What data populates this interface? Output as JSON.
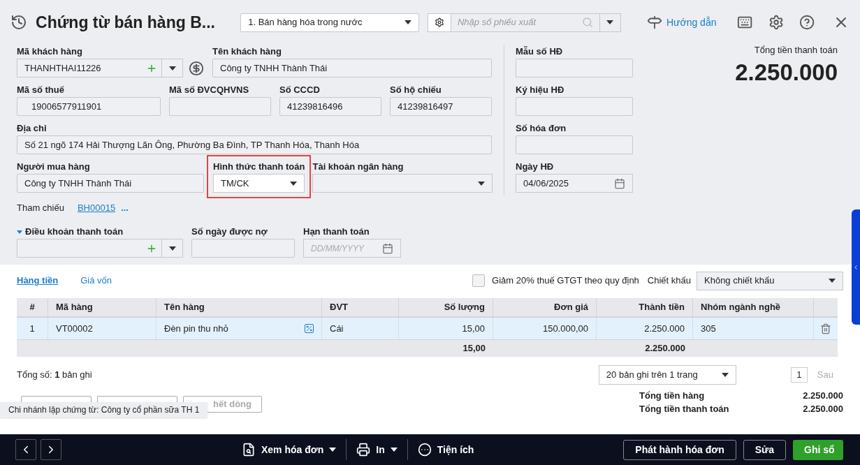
{
  "header": {
    "title": "Chứng từ bán hàng B...",
    "voucher_type": "1. Bán hàng hóa trong nước",
    "search": {
      "placeholder": "Nhập số phiếu xuất"
    },
    "guide": "Hướng dẫn"
  },
  "customer": {
    "code_label": "Mã khách hàng",
    "code": "THANHTHAI11226",
    "name_label": "Tên khách hàng",
    "name": "Công ty TNHH Thành Thái"
  },
  "ids": [
    {
      "label": "Mã số thuế",
      "value": "19006577911901"
    },
    {
      "label": "Mã số ĐVCQHVNS"
    },
    {
      "label": "Số CCCD",
      "value": "41239816496"
    },
    {
      "label": "Số hộ chiếu",
      "value": "41239816497"
    }
  ],
  "address": {
    "label": "Địa chỉ",
    "value": "Số 21 ngõ 174 Hải Thượng Lãn Ông, Phường Ba Đình, TP Thanh Hóa, Thanh Hóa"
  },
  "buyer": {
    "label": "Người mua hàng",
    "value": "Công ty TNHH Thành Thái"
  },
  "payment_method": {
    "label": "Hình thức thanh toán",
    "value": "TM/CK",
    "highlighted": true
  },
  "bank_account": {
    "label": "Tài khoản ngân hàng"
  },
  "reference": {
    "label": "Tham chiếu",
    "link": "BH00015",
    "more": "..."
  },
  "terms": {
    "label": "Điều khoản thanh toán",
    "expanded": true,
    "days_label": "Số ngày được nợ",
    "due_label": "Hạn thanh toán",
    "due_placeholder": "DD/MM/YYYY"
  },
  "invoice": [
    {
      "label": "Mẫu số HĐ",
      "kind": "text"
    },
    {
      "label": "Ký hiệu HĐ",
      "kind": "text"
    },
    {
      "label": "Số hóa đơn",
      "kind": "text"
    },
    {
      "label": "Ngày HĐ",
      "value": "04/06/2025",
      "kind": "date"
    }
  ],
  "total": {
    "label": "Tổng tiền thanh toán",
    "value": "2.250.000"
  },
  "tabs": [
    {
      "label": "Hàng tiền",
      "selected": true
    },
    {
      "label": "Giá vốn",
      "selected": false
    }
  ],
  "vat_reduction": {
    "label": "Giảm 20% thuế GTGT theo quy định",
    "checked": false
  },
  "discount": {
    "label": "Chiết khấu",
    "value": "Không chiết khấu"
  },
  "table": {
    "columns": [
      "#",
      "Mã hàng",
      "Tên hàng",
      "ĐVT",
      "Số lượng",
      "Đơn giá",
      "Thành tiền",
      "Nhóm ngành nghề"
    ],
    "rows": [
      {
        "cells": [
          "1",
          "VT00002",
          "Đèn pin thu nhỏ",
          "Cái",
          "15,00",
          "150.000,00",
          "2.250.000",
          "305"
        ],
        "selected": true
      }
    ],
    "totals": {
      "quantity": "15,00",
      "amount": "2.250.000"
    }
  },
  "record_count": "Tổng số: **1** bản ghi",
  "pagination": {
    "page_size": "20 bản ghi trên 1 trang",
    "page": "1",
    "next": "Sau"
  },
  "row_buttons": [
    {
      "kind": "button"
    },
    {
      "kind": "button"
    },
    {
      "kind": "button",
      "label": "hết dòng"
    }
  ],
  "branch_tooltip": "Chi nhánh lập chứng từ: Công ty cổ phần sữa TH 1",
  "summary": [
    {
      "label": "Tổng tiền hàng",
      "value": "2.250.000"
    },
    {
      "label": "Tổng tiền thanh toán",
      "value": "2.250.000"
    }
  ],
  "footer": {
    "tools": [
      {
        "label": "Xem hóa đơn",
        "kind": "view"
      },
      {
        "label": "In",
        "kind": "print"
      },
      {
        "label": "Tiện ích",
        "kind": "utility"
      }
    ],
    "buttons": [
      {
        "label": "Phát hành hóa đơn",
        "kind": "outline"
      },
      {
        "label": "Sửa",
        "kind": "outline"
      },
      {
        "label": "Ghi sổ",
        "kind": "primary"
      }
    ]
  }
}
